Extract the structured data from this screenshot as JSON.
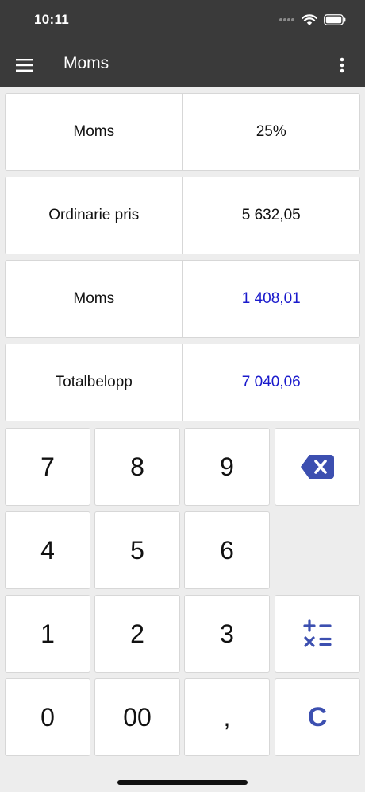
{
  "status_bar": {
    "time": "10:11"
  },
  "app_bar": {
    "title": "Moms",
    "menu_icon": "hamburger-menu-icon",
    "more_icon": "more-vertical-icon"
  },
  "rows": [
    {
      "label": "Moms",
      "value": "25%"
    },
    {
      "label": "Ordinarie pris",
      "value": "5 632,05"
    },
    {
      "label": "Moms",
      "value": "1 408,01"
    },
    {
      "label": "Totalbelopp",
      "value": "7 040,06"
    }
  ],
  "keypad": {
    "k7": "7",
    "k8": "8",
    "k9": "9",
    "k4": "4",
    "k5": "5",
    "k6": "6",
    "k1": "1",
    "k2": "2",
    "k3": "3",
    "k0": "0",
    "k00": "00",
    "comma": ",",
    "clear": "C",
    "backspace_icon": "backspace-icon",
    "operators_icon": "calculator-operators-icon"
  },
  "colors": {
    "app_bar": "#3a3a3a",
    "accent": "#3c4fb0",
    "result_text": "#1a1acc"
  }
}
